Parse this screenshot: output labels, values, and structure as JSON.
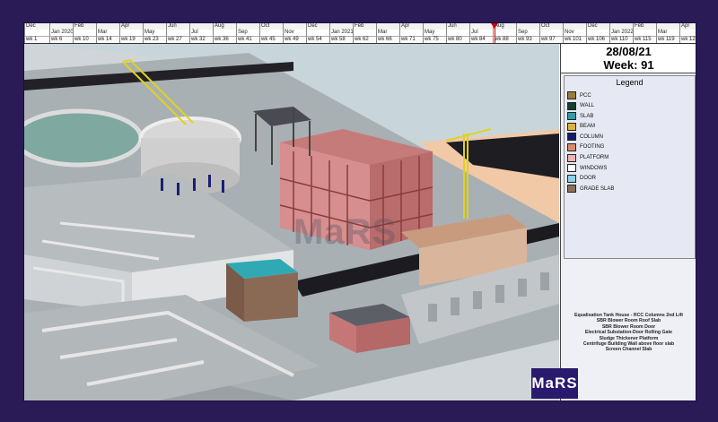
{
  "timeline": {
    "months": [
      {
        "label": "Dec",
        "w": 28
      },
      {
        "label": "Jan 2020",
        "w": 26
      },
      {
        "label": "Feb",
        "w": 26
      },
      {
        "label": "Mar",
        "w": 26
      },
      {
        "label": "Apr",
        "w": 26
      },
      {
        "label": "May",
        "w": 26
      },
      {
        "label": "Jun",
        "w": 26
      },
      {
        "label": "Jul",
        "w": 26
      },
      {
        "label": "Aug",
        "w": 26
      },
      {
        "label": "Sep",
        "w": 26
      },
      {
        "label": "Oct",
        "w": 26
      },
      {
        "label": "Nov",
        "w": 26
      },
      {
        "label": "Dec",
        "w": 26
      },
      {
        "label": "Jan 2021",
        "w": 26
      },
      {
        "label": "Feb",
        "w": 26
      },
      {
        "label": "Mar",
        "w": 26
      },
      {
        "label": "Apr",
        "w": 26
      },
      {
        "label": "May",
        "w": 26
      },
      {
        "label": "Jun",
        "w": 26
      },
      {
        "label": "Jul",
        "w": 26
      },
      {
        "label": "Aug",
        "w": 26
      },
      {
        "label": "Sep",
        "w": 26
      },
      {
        "label": "Oct",
        "w": 26
      },
      {
        "label": "Nov",
        "w": 26
      },
      {
        "label": "Dec",
        "w": 26
      },
      {
        "label": "Jan 2022",
        "w": 26
      },
      {
        "label": "Feb",
        "w": 26
      },
      {
        "label": "Mar",
        "w": 26
      },
      {
        "label": "Apr",
        "w": 26
      },
      {
        "label": "May",
        "w": 18
      }
    ],
    "weeks": [
      "wk 1",
      "wk 6",
      "wk 10",
      "wk 14",
      "wk 19",
      "wk 23",
      "wk 27",
      "wk 32",
      "wk 36",
      "wk 41",
      "wk 45",
      "wk 49",
      "wk 54",
      "wk 58",
      "wk 62",
      "wk 66",
      "wk 71",
      "wk 75",
      "wk 80",
      "wk 84",
      "wk 88",
      "wk 93",
      "wk 97",
      "wk 101",
      "wk 106",
      "wk 110",
      "wk 115",
      "wk 119",
      "wk 123",
      "wk 1"
    ]
  },
  "status": {
    "date": "28/08/21",
    "week": "Week: 91"
  },
  "legend": {
    "title": "Legend",
    "items": [
      {
        "label": "PCC",
        "color": "#9a7b3c"
      },
      {
        "label": "WALL",
        "color": "#17402a"
      },
      {
        "label": "SLAB",
        "color": "#2f9fa8"
      },
      {
        "label": "BEAM",
        "color": "#e0b040"
      },
      {
        "label": "COLUMN",
        "color": "#161a6a"
      },
      {
        "label": "FOOTING",
        "color": "#d98b6a"
      },
      {
        "label": "PLATFORM",
        "color": "#e9b5b5"
      },
      {
        "label": "WINDOWS",
        "color": "#ffffff"
      },
      {
        "label": "DOOR",
        "color": "#8fd0e8"
      },
      {
        "label": "GRADE SLAB",
        "color": "#8a6f5a"
      }
    ]
  },
  "activities": [
    "Equalisation Tank House - RCC Columns 2nd Lift",
    "SBR Blower Room Roof Slab",
    "SBR Blower Room Door",
    "Electrical Substation-Door Rolling Gate",
    "Sludge Thickener Platform",
    "Centrifuge Building Wall above floor slab",
    "Screen Channel Slab"
  ],
  "watermark": "MaRS",
  "logo": "MaRS",
  "colors": {
    "outer_bg": "#2a1a55",
    "marker": "#cc0000",
    "logo_bg": "#2a1a6e"
  }
}
